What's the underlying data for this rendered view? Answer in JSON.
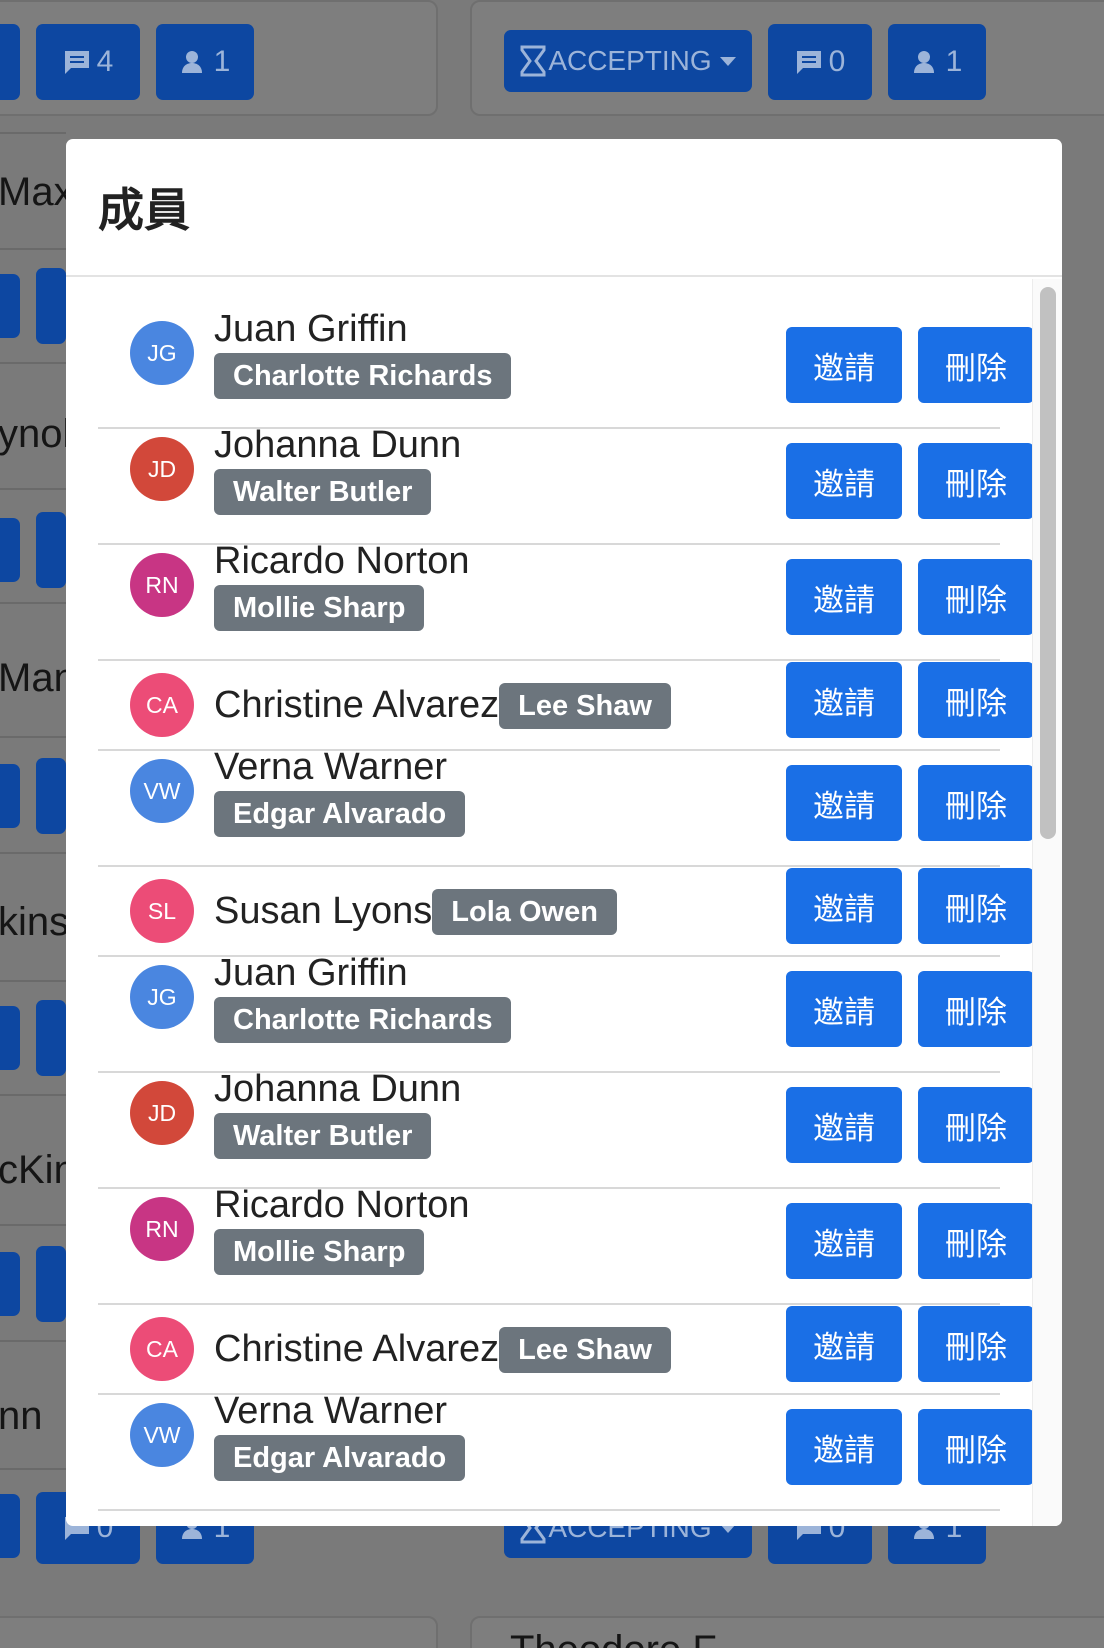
{
  "background": {
    "left_card_top": {
      "comments": "4",
      "members": "1"
    },
    "right_card_top": {
      "status": "ACCEPTING",
      "comments": "0",
      "members": "1"
    },
    "left_card_bottom": {
      "comments": "0",
      "members": "1"
    },
    "right_card_bottom": {
      "status": "ACCEPTING",
      "comments": "0",
      "members": "1"
    },
    "left_text": [
      "Max",
      "ynol",
      "Mann",
      "kins",
      "cKin",
      "nn"
    ],
    "bottom_right_text": "Theodore F"
  },
  "modal": {
    "title": "成員",
    "invite_label": "邀請",
    "delete_label": "刪除",
    "members": [
      {
        "initials": "JG",
        "name": "Juan Griffin",
        "badge": "Charlotte Richards",
        "color": "#4a86e0"
      },
      {
        "initials": "JD",
        "name": "Johanna Dunn",
        "badge": "Walter Butler",
        "color": "#d2483a"
      },
      {
        "initials": "RN",
        "name": "Ricardo Norton",
        "badge": "Mollie Sharp",
        "color": "#c83584"
      },
      {
        "initials": "CA",
        "name": "Christine Alvarez",
        "badge": "Lee Shaw",
        "color": "#ec4c77"
      },
      {
        "initials": "VW",
        "name": "Verna Warner",
        "badge": "Edgar Alvarado",
        "color": "#4a86e0"
      },
      {
        "initials": "SL",
        "name": "Susan Lyons",
        "badge": "Lola Owen",
        "color": "#ec4c77"
      },
      {
        "initials": "JG",
        "name": "Juan Griffin",
        "badge": "Charlotte Richards",
        "color": "#4a86e0"
      },
      {
        "initials": "JD",
        "name": "Johanna Dunn",
        "badge": "Walter Butler",
        "color": "#d2483a"
      },
      {
        "initials": "RN",
        "name": "Ricardo Norton",
        "badge": "Mollie Sharp",
        "color": "#c83584"
      },
      {
        "initials": "CA",
        "name": "Christine Alvarez",
        "badge": "Lee Shaw",
        "color": "#ec4c77"
      },
      {
        "initials": "VW",
        "name": "Verna Warner",
        "badge": "Edgar Alvarado",
        "color": "#4a86e0"
      }
    ]
  }
}
